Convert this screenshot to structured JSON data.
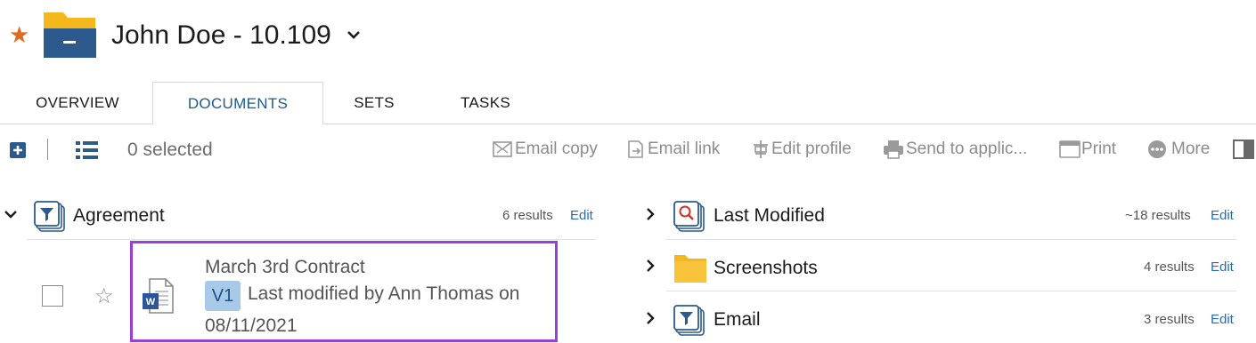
{
  "header": {
    "title": "John Doe - 10.109",
    "favorite_icon": "star-icon",
    "workspace_icon": "folder-icon",
    "accent": "#e06a1e",
    "folder_colors": {
      "top": "#f5b81c",
      "body": "#2c5a8c"
    }
  },
  "tabs": [
    {
      "label": "OVERVIEW",
      "active": false
    },
    {
      "label": "DOCUMENTS",
      "active": true
    },
    {
      "label": "SETS",
      "active": false
    },
    {
      "label": "TASKS",
      "active": false
    }
  ],
  "toolbar": {
    "selected_label": "0 selected",
    "actions": [
      {
        "label": "Email copy",
        "icon": "email-copy-icon"
      },
      {
        "label": "Email link",
        "icon": "email-link-icon"
      },
      {
        "label": "Edit profile",
        "icon": "edit-profile-icon"
      },
      {
        "label": "Send to applic...",
        "icon": "printer-icon"
      },
      {
        "label": "Print",
        "icon": "print-icon"
      },
      {
        "label": "More",
        "icon": "more-icon"
      }
    ]
  },
  "left_section": {
    "title": "Agreement",
    "results": "6 results",
    "edit_label": "Edit",
    "document": {
      "title": "March 3rd Contract",
      "version": "V1",
      "meta": "Last modified by Ann Thomas on",
      "date": "08/11/2021",
      "icon": "word-document-icon"
    }
  },
  "right_sections": [
    {
      "title": "Last Modified",
      "results": "~18 results",
      "edit_label": "Edit",
      "icon": "search-stack-icon"
    },
    {
      "title": "Screenshots",
      "results": "4 results",
      "edit_label": "Edit",
      "icon": "folder-icon"
    },
    {
      "title": "Email",
      "results": "3 results",
      "edit_label": "Edit",
      "icon": "filter-stack-icon"
    }
  ]
}
